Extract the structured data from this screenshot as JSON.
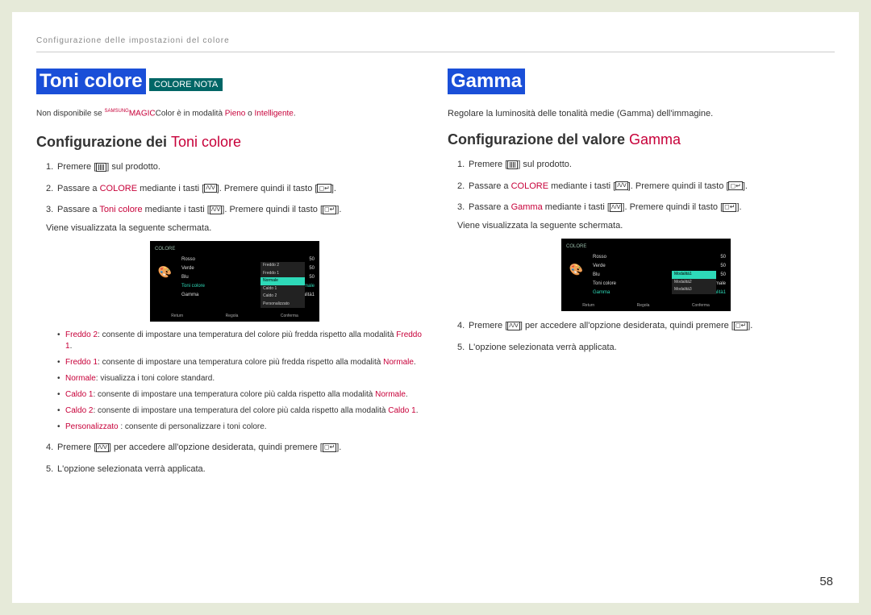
{
  "breadcrumb": "Configurazione delle impostazioni del colore",
  "pageNumber": "58",
  "left": {
    "title": "Toni colore",
    "noteBadge": "COLORE NOTA",
    "note_prefix": "Non disponibile se ",
    "note_magic_sup": "SAMSUNG",
    "note_magic": "MAGIC",
    "note_magic_suffix": "Color",
    "note_mid": " è in modalità ",
    "note_mode1": "Pieno",
    "note_or": " o ",
    "note_mode2": "Intelligente",
    "note_end": ".",
    "sectionTitle_pre": "Configurazione dei ",
    "sectionTitle_accent": "Toni colore",
    "step1_pre": "Premere [",
    "step1_post": "] sul prodotto.",
    "step2_pre": "Passare a ",
    "step2_accent": "COLORE",
    "step2_mid": " mediante i tasti [",
    "step2_mid2": "]. Premere quindi il tasto [",
    "step2_post": "].",
    "step3_pre": "Passare a ",
    "step3_accent": "Toni colore",
    "step3_mid": " mediante i tasti [",
    "step3_mid2": "]. Premere quindi il tasto [",
    "step3_post": "].",
    "step3_line2": "Viene visualizzata la seguente schermata.",
    "step4_pre": "Premere [",
    "step4_mid": "] per accedere all'opzione desiderata, quindi premere [",
    "step4_post": "].",
    "step5": "L'opzione selezionata verrà applicata.",
    "bullets": {
      "b1_a": "Freddo 2",
      "b1_t": ": consente di impostare una temperatura del colore più fredda rispetto alla modalità ",
      "b1_e": "Freddo 1",
      "b1_d": ".",
      "b2_a": "Freddo 1",
      "b2_t": ": consente di impostare una temperatura colore più fredda rispetto alla modalità ",
      "b2_e": "Normale",
      "b2_d": ".",
      "b3_a": "Normale",
      "b3_t": ": visualizza i toni colore standard.",
      "b4_a": "Caldo 1",
      "b4_t": ": consente di impostare una temperatura colore più calda rispetto alla modalità ",
      "b4_e": "Normale",
      "b4_d": ".",
      "b5_a": "Caldo 2",
      "b5_t": ": consente di impostare una temperatura del colore più calda rispetto alla modalità ",
      "b5_e": "Caldo 1",
      "b5_d": ".",
      "b6_a": "Personalizzato",
      "b6_t": " : consente di personalizzare i toni colore."
    },
    "ss": {
      "title": "COLORE",
      "rows": [
        {
          "label": "Rosso",
          "val": "50"
        },
        {
          "label": "Verde",
          "val": "50"
        },
        {
          "label": "Blu",
          "val": "50"
        },
        {
          "label": "Toni colore",
          "val": "Normale",
          "sel": true
        },
        {
          "label": "Gamma",
          "val": "Modalità1"
        }
      ],
      "submenu": [
        "Freddo 2",
        "Freddo 1",
        "Normale",
        "Caldo 1",
        "Caldo 2",
        "Personalizzato"
      ],
      "submenu_hl": 2,
      "footer": [
        "Return",
        "Regola",
        "Conferma"
      ]
    }
  },
  "right": {
    "title": "Gamma",
    "intro": "Regolare la luminosità delle tonalità medie (Gamma) dell'immagine.",
    "sectionTitle_pre": "Configurazione del valore ",
    "sectionTitle_accent": "Gamma",
    "step1_pre": "Premere [",
    "step1_post": "] sul prodotto.",
    "step2_pre": "Passare a ",
    "step2_accent": "COLORE",
    "step2_mid": " mediante i tasti [",
    "step2_mid2": "]. Premere quindi il tasto [",
    "step2_post": "].",
    "step3_pre": "Passare a ",
    "step3_accent": "Gamma",
    "step3_mid": " mediante i tasti [",
    "step3_mid2": "]. Premere quindi il tasto [",
    "step3_post": "].",
    "step3_line2": "Viene visualizzata la seguente schermata.",
    "step4_pre": "Premere [",
    "step4_mid": "] per accedere all'opzione desiderata, quindi premere [",
    "step4_post": "].",
    "step5": "L'opzione selezionata verrà applicata.",
    "ss": {
      "title": "COLORE",
      "rows": [
        {
          "label": "Rosso",
          "val": "50"
        },
        {
          "label": "Verde",
          "val": "50"
        },
        {
          "label": "Blu",
          "val": "50"
        },
        {
          "label": "Toni colore",
          "val": "Normale"
        },
        {
          "label": "Gamma",
          "val": "Modalità1",
          "sel": true
        }
      ],
      "submenu": [
        "Modalità1",
        "Modalità2",
        "Modalità3"
      ],
      "submenu_hl": 0,
      "footer": [
        "Return",
        "Regola",
        "Conferma"
      ]
    }
  }
}
